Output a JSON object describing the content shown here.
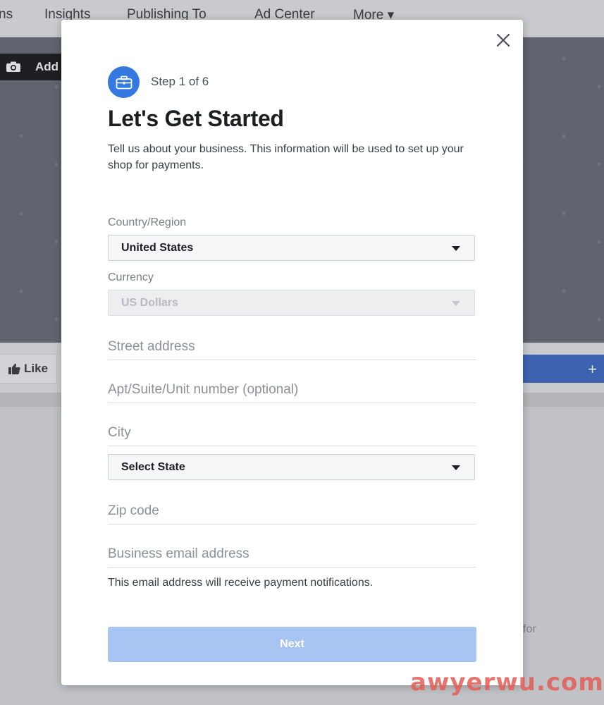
{
  "background": {
    "nav_items": [
      "ns",
      "Insights",
      "Publishing To",
      "Ad Center",
      "More ▾"
    ],
    "add_photo_label": "Add",
    "like_label": "Like",
    "plus_label": "+",
    "partial_text": "for"
  },
  "modal": {
    "step_label": "Step 1 of 6",
    "title": "Let's Get Started",
    "subtitle": "Tell us about your business. This information will be used to set up your shop for payments.",
    "country_label": "Country/Region",
    "country_value": "United States",
    "currency_label": "Currency",
    "currency_value": "US Dollars",
    "street_placeholder": "Street address",
    "apt_placeholder": "Apt/Suite/Unit number (optional)",
    "city_placeholder": "City",
    "state_value": "Select State",
    "zip_placeholder": "Zip code",
    "email_placeholder": "Business email address",
    "email_helper": "This email address will receive payment notifications.",
    "next_label": "Next"
  },
  "watermark": "awyerwu.com",
  "colors": {
    "accent": "#3579e0",
    "next_button_disabled": "#a7c4f2",
    "watermark": "#e35d57"
  }
}
